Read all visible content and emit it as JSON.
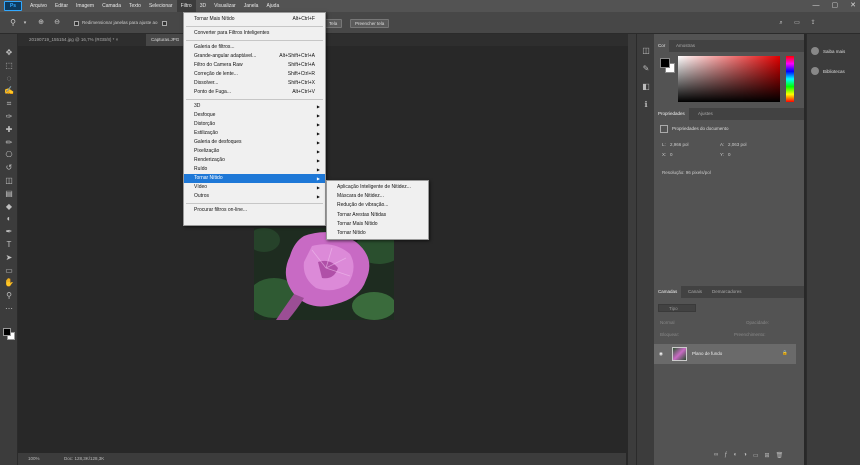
{
  "app": {
    "logo": "Ps",
    "window_controls": [
      "—",
      "▢",
      "✕"
    ]
  },
  "menubar": [
    {
      "label": "Arquivo",
      "active": false
    },
    {
      "label": "Editar",
      "active": false
    },
    {
      "label": "Imagem",
      "active": false
    },
    {
      "label": "Camada",
      "active": false
    },
    {
      "label": "Texto",
      "active": false
    },
    {
      "label": "Selecionar",
      "active": false
    },
    {
      "label": "Filtro",
      "active": true
    },
    {
      "label": "3D",
      "active": false
    },
    {
      "label": "Visualizar",
      "active": false
    },
    {
      "label": "Janela",
      "active": false
    },
    {
      "label": "Ajuda",
      "active": false
    }
  ],
  "options_bar": {
    "resize_windows_label": "Redimensionar janelas para ajuste ao",
    "fit_screen_button": "Tela",
    "fill_screen_button": "Preencher tela"
  },
  "tabs": [
    {
      "label": "20190719_155154.jpg @ 16,7% (RGB/8) *",
      "active": false
    },
    {
      "label": "Capturas.JPG",
      "active": true
    }
  ],
  "status_bar": {
    "zoom": "100%",
    "doc_info": "Doc: 128,3K/128,3K"
  },
  "filter_menu": {
    "items": [
      {
        "label": "Tornar Mais Nítido",
        "shortcut": "Alt+Ctrl+F"
      },
      {
        "sep": true
      },
      {
        "label": "Converter para Filtros Inteligentes"
      },
      {
        "sep": true
      },
      {
        "label": "Galeria de filtros..."
      },
      {
        "label": "Grande-angular adaptável...",
        "shortcut": "Alt+Shift+Ctrl+A"
      },
      {
        "label": "Filtro do Camera Raw",
        "shortcut": "Shift+Ctrl+A"
      },
      {
        "label": "Correção de lente...",
        "shortcut": "Shift+Ctrl+R"
      },
      {
        "label": "Dissolver...",
        "shortcut": "Shift+Ctrl+X"
      },
      {
        "label": "Ponto de Fuga...",
        "shortcut": "Alt+Ctrl+V"
      },
      {
        "sep": true
      },
      {
        "label": "3D",
        "sub": true
      },
      {
        "label": "Desfoque",
        "sub": true
      },
      {
        "label": "Distorção",
        "sub": true
      },
      {
        "label": "Estilização",
        "sub": true
      },
      {
        "label": "Galeria de desfoques",
        "sub": true
      },
      {
        "label": "Pixelização",
        "sub": true
      },
      {
        "label": "Renderização",
        "sub": true
      },
      {
        "label": "Ruído",
        "sub": true
      },
      {
        "label": "Tornar Nítido",
        "sub": true,
        "highlight": true
      },
      {
        "label": "Vídeo",
        "sub": true
      },
      {
        "label": "Outros",
        "sub": true
      },
      {
        "sep": true
      },
      {
        "label": "Procurar filtros on-line..."
      }
    ]
  },
  "sharpen_submenu": {
    "items": [
      "Aplicação Inteligente de Nitidez...",
      "Máscara de Nitidez...",
      "Redução de vibração...",
      "Tornar Arestas Nítidas",
      "Tornar Mais Nítido",
      "Tornar Nítido"
    ]
  },
  "color_panel": {
    "tabs": [
      "Cor",
      "Amostras"
    ]
  },
  "properties_panel": {
    "tabs": [
      "Propriedades",
      "Ajustes"
    ],
    "doc_title": "Propriedades do documento",
    "w_label": "L:",
    "w_value": "2,966 pol",
    "h_label": "A:",
    "h_value": "2,063 pol",
    "x_label": "X:",
    "x_value": "0",
    "y_label": "Y:",
    "y_value": "0",
    "resolution": "Resolução: 96 pixels/pol"
  },
  "layers_panel": {
    "tabs": [
      "Camadas",
      "Canais",
      "Demarcadores"
    ],
    "filter_placeholder": "Tipo",
    "blend_mode": "Normal",
    "opacity_label": "Opacidade:",
    "lock_label": "Bloquear:",
    "fill_label": "Preenchimento:",
    "layer_name": "Plano de fundo"
  },
  "learn_panel": {
    "items": [
      "Saiba mais",
      "Bibliotecas"
    ]
  },
  "colors": {
    "accent": "#1e78d7",
    "panel": "#535353",
    "canvas": "#282828"
  }
}
